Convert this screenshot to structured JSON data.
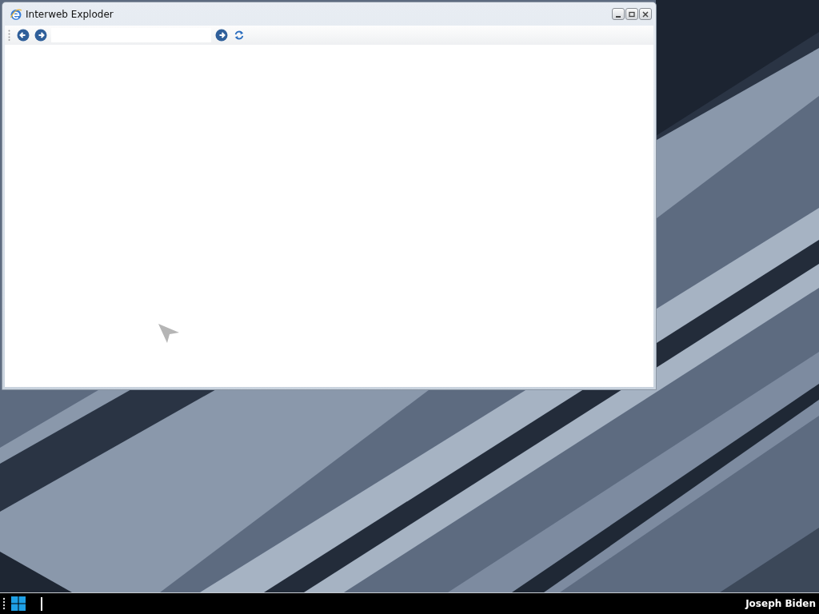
{
  "window": {
    "title": "Interweb Exploder"
  },
  "taskbar": {
    "user_name": "Joseph Biden"
  }
}
